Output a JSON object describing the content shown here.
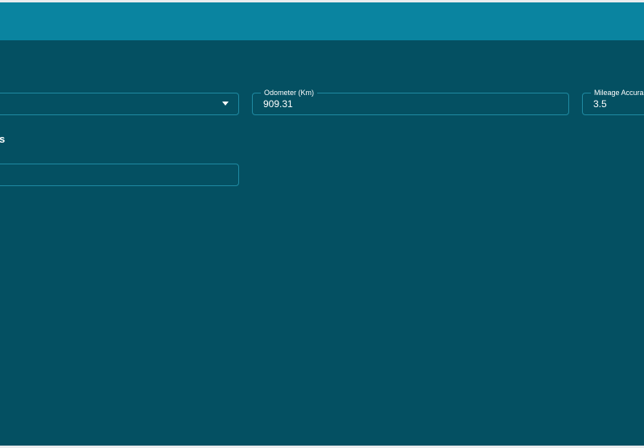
{
  "form": {
    "select_field": {
      "label": "",
      "value": ""
    },
    "odometer": {
      "label": "Odometer (Km)",
      "value": "909.31"
    },
    "mileage_accuracy": {
      "label": "Mileage Accura",
      "value": "3.5"
    },
    "section_heading": "s",
    "text_field": {
      "value": ""
    }
  },
  "colors": {
    "header": "#0a84a0",
    "panel": "#045062",
    "field_border": "#1f8aa2",
    "text": "#ffffff"
  },
  "icons": {
    "dropdown": "caret-down-icon"
  }
}
